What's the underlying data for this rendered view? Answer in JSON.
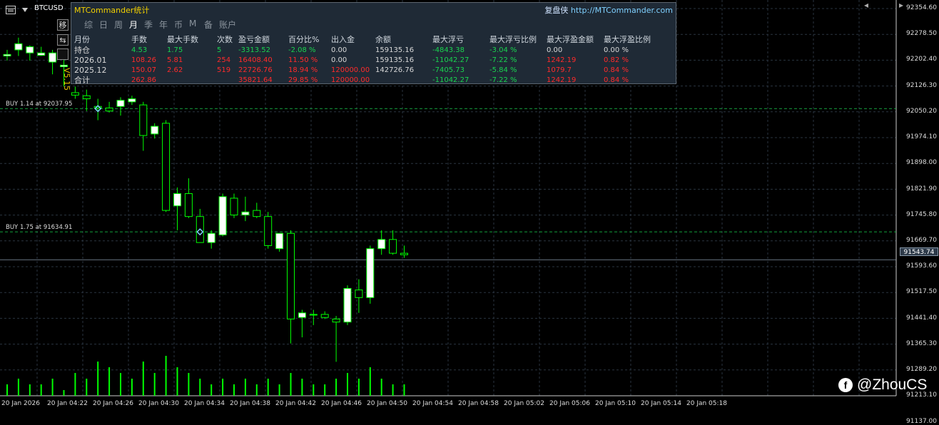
{
  "symbol": "BTCUSD",
  "current_price": "91543.74",
  "version": "V5.15",
  "side_buttons": [
    "移",
    "⇆"
  ],
  "panel": {
    "title": "MTCommander统计",
    "brand": "复盘侠",
    "url": "http://MTCommander.com",
    "tabs": [
      "综",
      "日",
      "周",
      "月",
      "季",
      "年",
      "币",
      "M",
      "备",
      "账户"
    ],
    "active_tab": 3,
    "headers": [
      "月份",
      "手数",
      "最大手数",
      "次数",
      "盈亏金额",
      "百分比%",
      "出入金",
      "余额",
      "最大浮亏",
      "最大浮亏比例",
      "最大浮盈金额",
      "最大浮盈比例"
    ],
    "rows": [
      {
        "cells": [
          "持仓",
          "4.53",
          "1.75",
          "5",
          "-3313.52",
          "-2.08 %",
          "0.00",
          "159135.16",
          "-4843.38",
          "-3.04 %",
          "0.00",
          "0.00 %"
        ],
        "colors": [
          "white",
          "green",
          "green",
          "green",
          "green",
          "green",
          "white",
          "white",
          "green",
          "green",
          "white",
          "white"
        ]
      },
      {
        "cells": [
          "2026.01",
          "108.26",
          "5.81",
          "254",
          "16408.40",
          "11.50 %",
          "0.00",
          "159135.16",
          "-11042.27",
          "-7.22 %",
          "1242.19",
          "0.82 %"
        ],
        "colors": [
          "white",
          "red",
          "red",
          "red",
          "red",
          "red",
          "white",
          "white",
          "green",
          "green",
          "red",
          "red"
        ]
      },
      {
        "cells": [
          "2025.12",
          "150.07",
          "2.62",
          "519",
          "22726.76",
          "18.94 %",
          "120000.00",
          "142726.76",
          "-7405.73",
          "-5.84 %",
          "1079.7",
          "0.84 %"
        ],
        "colors": [
          "white",
          "red",
          "red",
          "red",
          "red",
          "red",
          "red",
          "white",
          "green",
          "green",
          "red",
          "red"
        ]
      },
      {
        "cells": [
          "合计",
          "262.86",
          "",
          "",
          "35821.64",
          "29.85 %",
          "120000.00",
          "",
          "-11042.27",
          "-7.22 %",
          "1242.19",
          "0.84 %"
        ],
        "colors": [
          "white",
          "red",
          "red",
          "red",
          "red",
          "red",
          "red",
          "white",
          "green",
          "green",
          "red",
          "red"
        ]
      }
    ]
  },
  "price_axis": [
    "92354.60",
    "92278.50",
    "92202.40",
    "92126.30",
    "92050.20",
    "91974.10",
    "91898.00",
    "91821.90",
    "91745.80",
    "91669.70",
    "91593.60",
    "91517.50",
    "91441.40",
    "91365.30",
    "91289.20",
    "91213.10",
    "91137.00"
  ],
  "time_axis": [
    "20 Jan 2026",
    "20 Jan 04:22",
    "20 Jan 04:26",
    "20 Jan 04:30",
    "20 Jan 04:34",
    "20 Jan 04:38",
    "20 Jan 04:42",
    "20 Jan 04:46",
    "20 Jan 04:50",
    "20 Jan 04:54",
    "20 Jan 04:58",
    "20 Jan 05:02",
    "20 Jan 05:06",
    "20 Jan 05:10",
    "20 Jan 05:14",
    "20 Jan 05:18"
  ],
  "orders": [
    {
      "label": "BUY 1.14 at 92037.95",
      "price": 92037.95
    },
    {
      "label": "BUY 1.75 at 91634.91",
      "price": 91634.91
    }
  ],
  "watermark": "@ZhouCS",
  "watermark_icon": "facebook-icon",
  "colors": {
    "bull": "#ffffff",
    "bear": "#000000",
    "wick": "#00ff00",
    "grid": "#2a3440",
    "volume": "#00ff00"
  },
  "chart_data": {
    "type": "candlestick",
    "y_range": [
      91099,
      92393
    ],
    "candles": [
      {
        "o": 92210,
        "h": 92230,
        "l": 92195,
        "c": 92215
      },
      {
        "o": 92230,
        "h": 92270,
        "l": 92210,
        "c": 92250
      },
      {
        "o": 92220,
        "h": 92245,
        "l": 92195,
        "c": 92240
      },
      {
        "o": 92212,
        "h": 92240,
        "l": 92210,
        "c": 92220
      },
      {
        "o": 92190,
        "h": 92230,
        "l": 92150,
        "c": 92220
      },
      {
        "o": 92175,
        "h": 92200,
        "l": 92110,
        "c": 92180
      },
      {
        "o": 92090,
        "h": 92110,
        "l": 92070,
        "c": 92082
      },
      {
        "o": 92080,
        "h": 92100,
        "l": 92030,
        "c": 92070
      },
      {
        "o": 92045,
        "h": 92070,
        "l": 92000,
        "c": 92040
      },
      {
        "o": 92040,
        "h": 92060,
        "l": 92025,
        "c": 92030
      },
      {
        "o": 92045,
        "h": 92075,
        "l": 92015,
        "c": 92065
      },
      {
        "o": 92060,
        "h": 92080,
        "l": 92050,
        "c": 92070
      },
      {
        "o": 92050,
        "h": 92060,
        "l": 91900,
        "c": 91950
      },
      {
        "o": 91955,
        "h": 91990,
        "l": 91940,
        "c": 91980
      },
      {
        "o": 91990,
        "h": 92000,
        "l": 91700,
        "c": 91705
      },
      {
        "o": 91720,
        "h": 91780,
        "l": 91640,
        "c": 91760
      },
      {
        "o": 91760,
        "h": 91810,
        "l": 91680,
        "c": 91685
      },
      {
        "o": 91685,
        "h": 91710,
        "l": 91600,
        "c": 91600
      },
      {
        "o": 91600,
        "h": 91640,
        "l": 91580,
        "c": 91630
      },
      {
        "o": 91625,
        "h": 91760,
        "l": 91620,
        "c": 91750
      },
      {
        "o": 91745,
        "h": 91760,
        "l": 91680,
        "c": 91690
      },
      {
        "o": 91690,
        "h": 91750,
        "l": 91670,
        "c": 91700
      },
      {
        "o": 91705,
        "h": 91730,
        "l": 91680,
        "c": 91685
      },
      {
        "o": 91685,
        "h": 91700,
        "l": 91580,
        "c": 91590
      },
      {
        "o": 91580,
        "h": 91620,
        "l": 91570,
        "c": 91630
      },
      {
        "o": 91630,
        "h": 91640,
        "l": 91270,
        "c": 91350
      },
      {
        "o": 91355,
        "h": 91380,
        "l": 91290,
        "c": 91370
      },
      {
        "o": 91365,
        "h": 91380,
        "l": 91330,
        "c": 91365
      },
      {
        "o": 91365,
        "h": 91375,
        "l": 91350,
        "c": 91355
      },
      {
        "o": 91350,
        "h": 91360,
        "l": 91210,
        "c": 91340
      },
      {
        "o": 91340,
        "h": 91460,
        "l": 91330,
        "c": 91450
      },
      {
        "o": 91445,
        "h": 91480,
        "l": 91370,
        "c": 91420
      },
      {
        "o": 91420,
        "h": 91590,
        "l": 91400,
        "c": 91580
      },
      {
        "o": 91580,
        "h": 91640,
        "l": 91560,
        "c": 91610
      },
      {
        "o": 91610,
        "h": 91640,
        "l": 91560,
        "c": 91565
      },
      {
        "o": 91565,
        "h": 91590,
        "l": 91550,
        "c": 91560
      }
    ],
    "volume": [
      2,
      3,
      2,
      2,
      3,
      1,
      4,
      3,
      6,
      5,
      4,
      3,
      6,
      4,
      7,
      5,
      4,
      3,
      2,
      3,
      2,
      3,
      2,
      3,
      2,
      4,
      3,
      2,
      2,
      3,
      4,
      3,
      5,
      3,
      2,
      2
    ]
  }
}
